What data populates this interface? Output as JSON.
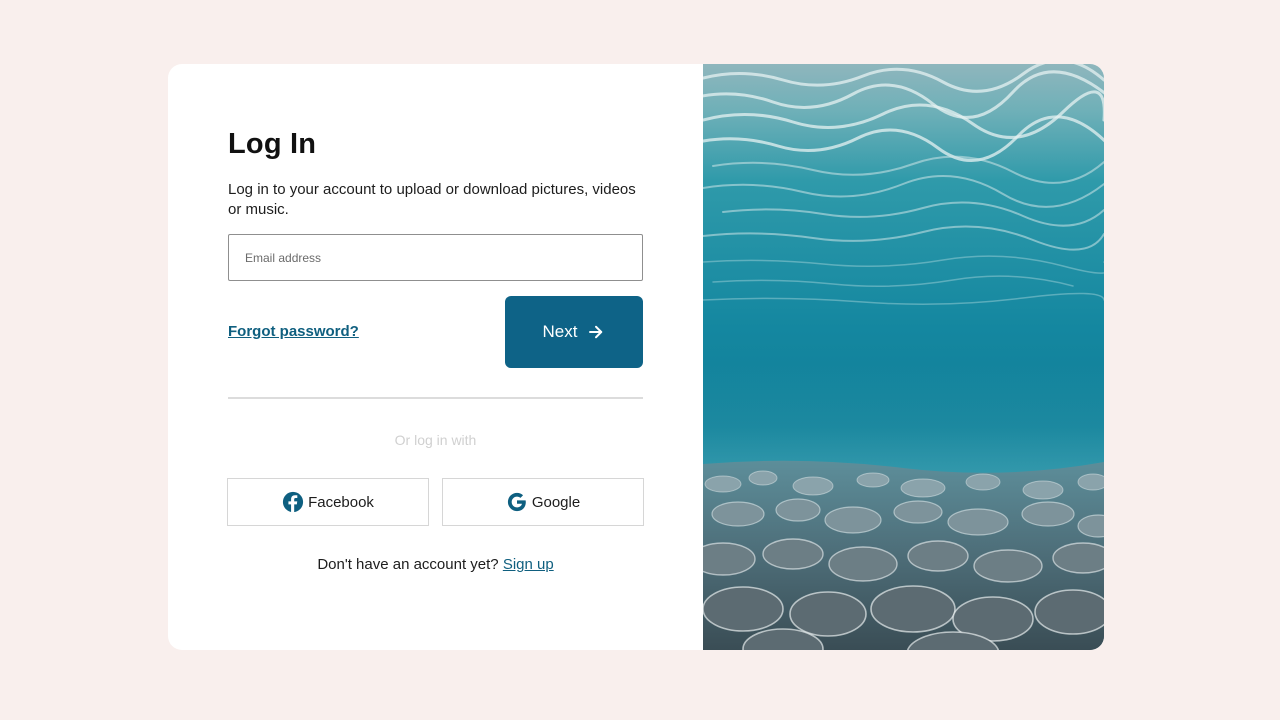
{
  "login": {
    "title": "Log In",
    "subtitle": "Log in to your account to upload or download pictures, videos or music.",
    "email_placeholder": "Email address",
    "email_value": "",
    "forgot_password": "Forgot password?",
    "next_label": "Next",
    "or_text": "Or log in with",
    "facebook_label": "Facebook",
    "google_label": "Google",
    "signup_prompt": "Don't have an account yet?",
    "signup_link": "Sign up"
  },
  "icons": {
    "next": "arrow-right-icon",
    "facebook": "facebook-icon",
    "google": "google-icon"
  },
  "colors": {
    "background": "#f9efed",
    "card": "#ffffff",
    "accent": "#0e6387",
    "link": "#0f5f7f",
    "muted_text": "#d0d0d0"
  }
}
